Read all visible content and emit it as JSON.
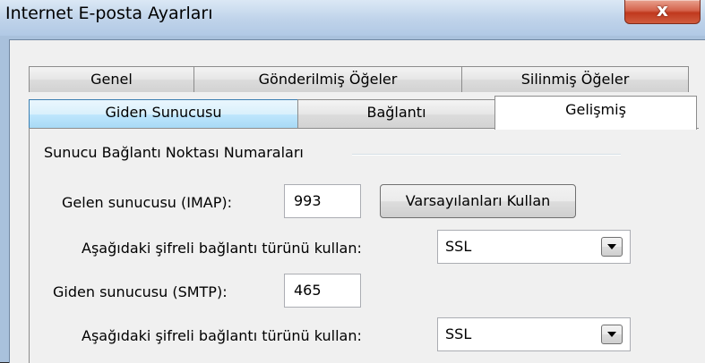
{
  "window": {
    "title": "Internet E-posta Ayarları",
    "close_glyph": "x"
  },
  "tabs": {
    "row_back": [
      {
        "label": "Genel"
      },
      {
        "label": "Gönderilmiş Öğeler"
      },
      {
        "label": "Silinmiş Öğeler"
      }
    ],
    "row_front": [
      {
        "label": "Giden Sunucusu",
        "state": "hover"
      },
      {
        "label": "Bağlantı"
      },
      {
        "label": "Gelişmiş",
        "state": "selected"
      }
    ]
  },
  "panel": {
    "group_title": "Sunucu Bağlantı Noktası Numaraları",
    "incoming": {
      "label": "Gelen sunucusu (IMAP):",
      "port": "993",
      "defaults_button": "Varsayılanları Kullan",
      "encryption_label": "Aşağıdaki şifreli bağlantı türünü kullan:",
      "encryption_value": "SSL"
    },
    "outgoing": {
      "label": "Giden sunucusu (SMTP):",
      "port": "465",
      "encryption_label": "Aşağıdaki şifreli bağlantı türünü kullan:",
      "encryption_value": "SSL"
    }
  },
  "colors": {
    "tab_hover": "#bee6fd",
    "close_button": "#c0391e"
  }
}
